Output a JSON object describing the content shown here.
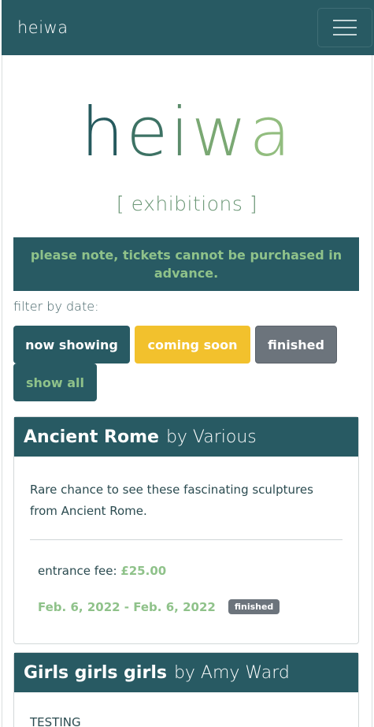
{
  "navbar": {
    "brand": "heiwa",
    "menu_icon": "hamburger-menu-icon"
  },
  "hero": {
    "title_letters": [
      "h",
      "e",
      "i",
      "w",
      "a"
    ],
    "subtitle": "[ exhibitions ]"
  },
  "notice": "please note, tickets cannot be purchased in advance.",
  "filter": {
    "label": "filter by date:",
    "buttons": {
      "now_showing": "now showing",
      "coming_soon": "coming soon",
      "finished": "finished",
      "show_all": "show all"
    }
  },
  "exhibitions": [
    {
      "title": "Ancient Rome",
      "by": "by Various",
      "description": "Rare chance to see these fascinating sculptures from Ancient Rome.",
      "fee_label": "entrance fee:",
      "fee": "£25.00",
      "dates": "Feb. 6, 2022 - Feb. 6, 2022",
      "status": "finished"
    },
    {
      "title": "Girls girls girls",
      "by": "by Amy Ward",
      "description": "TESTING"
    }
  ],
  "colors": {
    "primary": "#285a63",
    "accent_green": "#8fc28a",
    "warning": "#f2c12d",
    "secondary": "#6c747c"
  }
}
